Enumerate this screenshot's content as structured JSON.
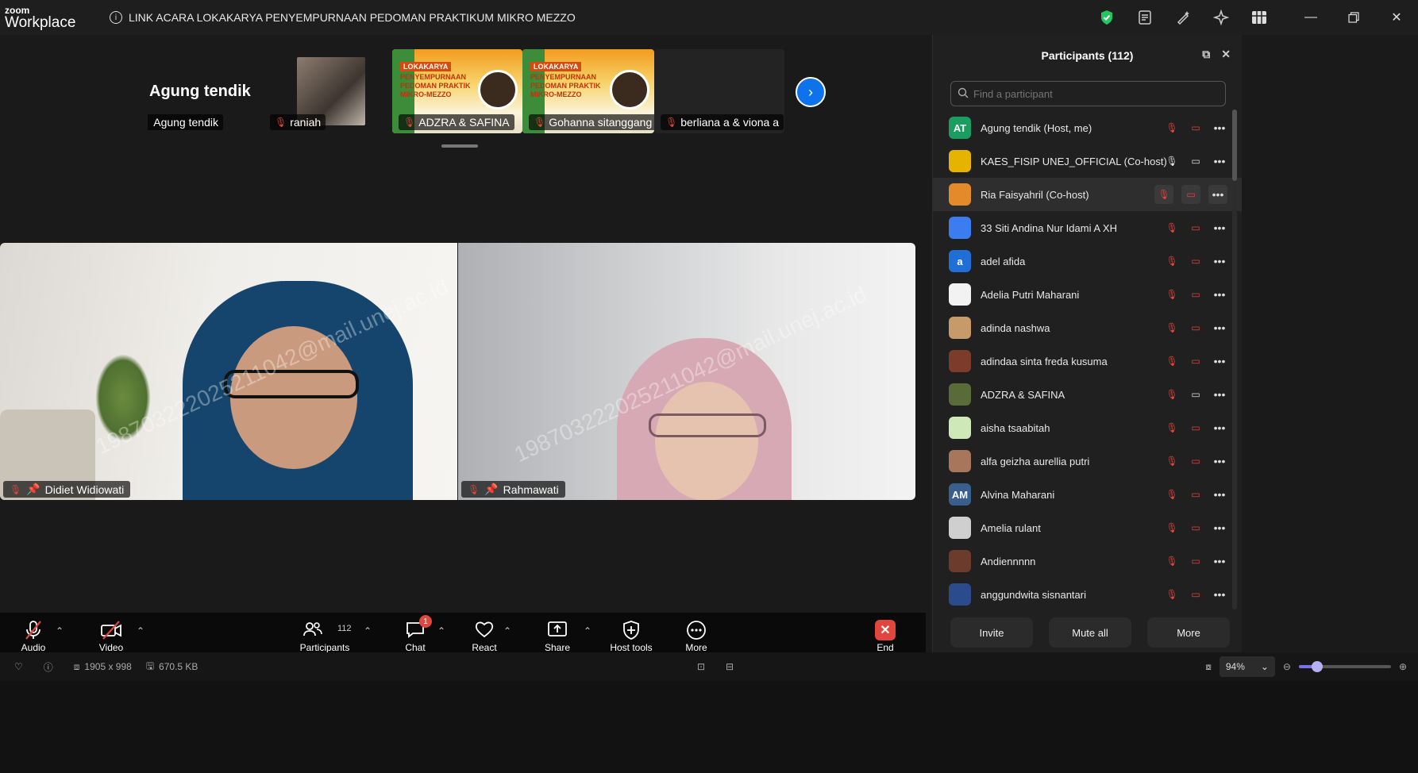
{
  "titlebar": {
    "logo_top": "zoom",
    "logo_bottom": "Workplace",
    "meeting_title": "LINK ACARA LOKAKARYA PENYEMPURNAAN PEDOMAN PRAKTIKUM MIKRO MEZZO",
    "icons": [
      "shield-check-icon",
      "notes-icon",
      "annotate-icon",
      "ai-companion-icon",
      "apps-icon"
    ],
    "window_controls": [
      "minimize-icon",
      "restore-icon",
      "close-icon"
    ]
  },
  "gallery": {
    "tiles": [
      {
        "big_name": "Agung tendik",
        "label": "Agung tendik"
      },
      {
        "label": "raniah"
      },
      {
        "label": "ADZRA & SAFINA",
        "banner_tag": "LOKAKARYA",
        "banner_title": "PENYEMPURNAAN PEDOMAN PRAKTIK MIKRO-MEZZO"
      },
      {
        "label": "Gohanna sitanggang (...",
        "banner_tag": "LOKAKARYA",
        "banner_title": "PENYEMPURNAAN PEDOMAN PRAKTIK MIKRO-MEZZO"
      },
      {
        "label": "berliana a & viona a"
      }
    ]
  },
  "videos": [
    {
      "name": "Didiet Widiowati",
      "watermark": "198703222025211042@mail.unej.ac.id"
    },
    {
      "name": "Rahmawati",
      "watermark": "198703222025211042@mail.unej.ac.id"
    }
  ],
  "toolbar": {
    "audio": "Audio",
    "video": "Video",
    "participants": "Participants",
    "participants_count": "112",
    "chat": "Chat",
    "chat_badge": "1",
    "react": "React",
    "share": "Share",
    "host_tools": "Host tools",
    "more": "More",
    "end": "End"
  },
  "panel": {
    "title": "Participants (112)",
    "search_placeholder": "Find a participant",
    "participants": [
      {
        "name": "Agung tendik (Host, me)",
        "avatar": "AT",
        "color": "#1a9e5f",
        "mic": "off",
        "cam": "off"
      },
      {
        "name": "KAES_FISIP UNEJ_OFFICIAL (Co-host)",
        "avatar": "",
        "color": "#e6b400",
        "mic": "on",
        "cam": "on"
      },
      {
        "name": "Ria Faisyahril (Co-host)",
        "avatar": "",
        "color": "#e48a2a",
        "mic": "off",
        "cam": "off"
      },
      {
        "name": "33 Siti Andina Nur Idami A XH",
        "avatar": "",
        "color": "#3b7df0",
        "mic": "off",
        "cam": "off"
      },
      {
        "name": "adel afida",
        "avatar": "a",
        "color": "#1f6fd6",
        "mic": "off",
        "cam": "off"
      },
      {
        "name": "Adelia Putri Maharani",
        "avatar": "",
        "color": "#f2f2f2",
        "mic": "off",
        "cam": "off"
      },
      {
        "name": "adinda nashwa",
        "avatar": "",
        "color": "#c79a6a",
        "mic": "off",
        "cam": "off"
      },
      {
        "name": "adindaa sinta freda kusuma",
        "avatar": "",
        "color": "#7d3b2c",
        "mic": "off",
        "cam": "off"
      },
      {
        "name": "ADZRA & SAFINA",
        "avatar": "",
        "color": "#5a6b3a",
        "mic": "off",
        "cam": "on"
      },
      {
        "name": "aisha tsaabitah",
        "avatar": "",
        "color": "#cfe8b8",
        "mic": "off",
        "cam": "off"
      },
      {
        "name": "alfa geizha aurellia putri",
        "avatar": "",
        "color": "#a8765a",
        "mic": "off",
        "cam": "off"
      },
      {
        "name": "Alvina Maharani",
        "avatar": "AM",
        "color": "#3a5f8c",
        "mic": "off",
        "cam": "off"
      },
      {
        "name": "Amelia rulant",
        "avatar": "",
        "color": "#cfcfcf",
        "mic": "off",
        "cam": "off"
      },
      {
        "name": "Andiennnnn",
        "avatar": "",
        "color": "#6b3b2c",
        "mic": "off",
        "cam": "off"
      },
      {
        "name": "anggundwita sisnantari",
        "avatar": "",
        "color": "#2c4b8c",
        "mic": "off",
        "cam": "off"
      }
    ],
    "buttons": {
      "invite": "Invite",
      "mute_all": "Mute all",
      "more": "More"
    }
  },
  "statusbar": {
    "resolution": "1905 x 998",
    "size": "670.5 KB",
    "zoom": "94%",
    "zoom_level": 0.2
  }
}
